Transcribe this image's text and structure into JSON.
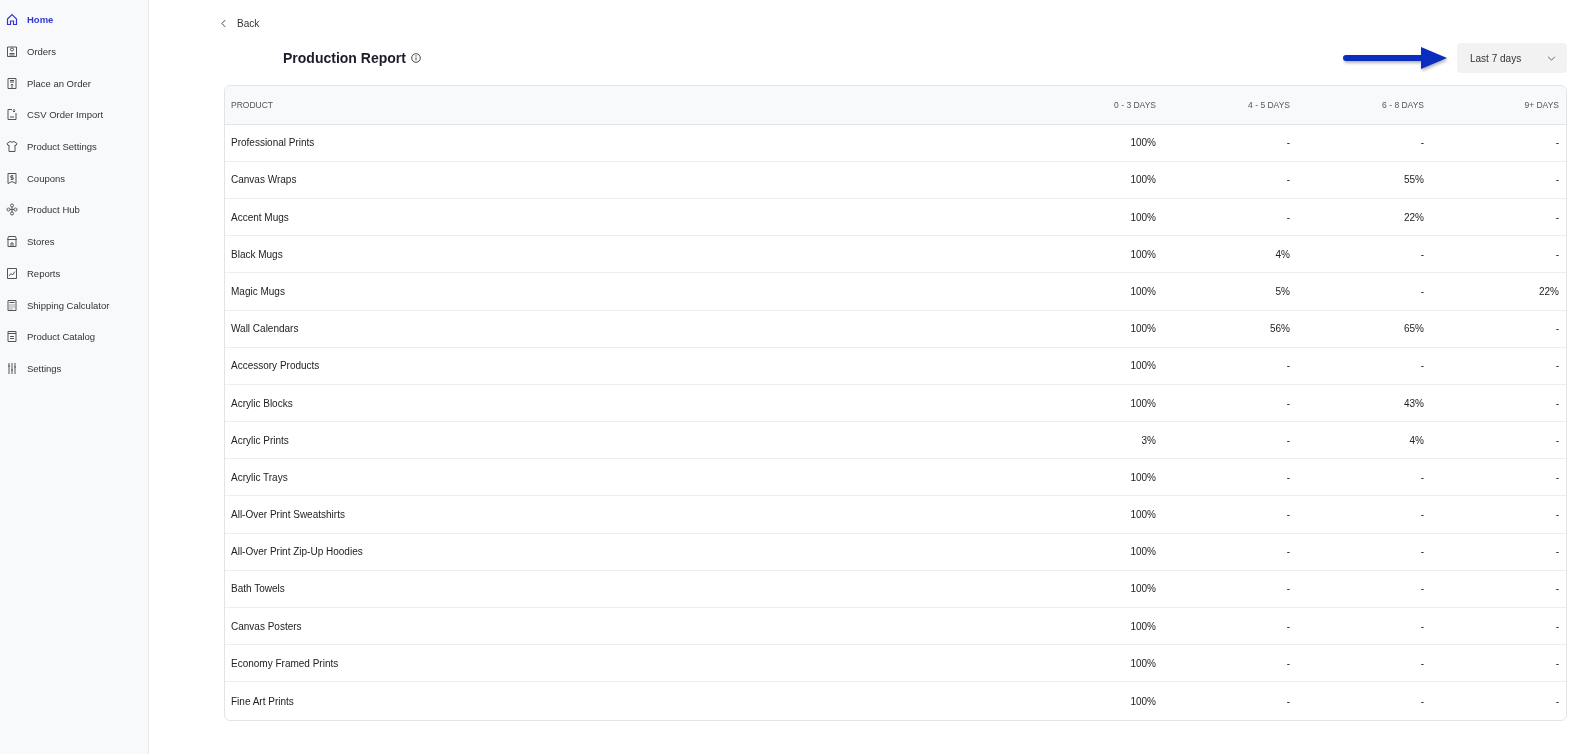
{
  "sidebar": {
    "items": [
      {
        "label": "Home",
        "selected": true
      },
      {
        "label": "Orders",
        "selected": false
      },
      {
        "label": "Place an Order",
        "selected": false
      },
      {
        "label": "CSV Order Import",
        "selected": false
      },
      {
        "label": "Product Settings",
        "selected": false
      },
      {
        "label": "Coupons",
        "selected": false
      },
      {
        "label": "Product Hub",
        "selected": false
      },
      {
        "label": "Stores",
        "selected": false
      },
      {
        "label": "Reports",
        "selected": false
      },
      {
        "label": "Shipping Calculator",
        "selected": false
      },
      {
        "label": "Product Catalog",
        "selected": false
      },
      {
        "label": "Settings",
        "selected": false
      }
    ]
  },
  "back_link": {
    "label": "Back"
  },
  "page_title": "Production Report",
  "date_range": {
    "value": "Last 7 days"
  },
  "table": {
    "columns": [
      "PRODUCT",
      "0 - 3 DAYS",
      "4 - 5 DAYS",
      "6 - 8 DAYS",
      "9+ DAYS"
    ],
    "rows": [
      [
        "Professional Prints",
        "100%",
        "-",
        "-",
        "-"
      ],
      [
        "Canvas Wraps",
        "100%",
        "-",
        "55%",
        "-"
      ],
      [
        "Accent Mugs",
        "100%",
        "-",
        "22%",
        "-"
      ],
      [
        "Black Mugs",
        "100%",
        "4%",
        "-",
        "-"
      ],
      [
        "Magic Mugs",
        "100%",
        "5%",
        "-",
        "22%"
      ],
      [
        "Wall Calendars",
        "100%",
        "56%",
        "65%",
        "-"
      ],
      [
        "Accessory Products",
        "100%",
        "-",
        "-",
        "-"
      ],
      [
        "Acrylic Blocks",
        "100%",
        "-",
        "43%",
        "-"
      ],
      [
        "Acrylic Prints",
        "3%",
        "-",
        "4%",
        "-"
      ],
      [
        "Acrylic Trays",
        "100%",
        "-",
        "-",
        "-"
      ],
      [
        "All-Over Print Sweatshirts",
        "100%",
        "-",
        "-",
        "-"
      ],
      [
        "All-Over Print Zip-Up Hoodies",
        "100%",
        "-",
        "-",
        "-"
      ],
      [
        "Bath Towels",
        "100%",
        "-",
        "-",
        "-"
      ],
      [
        "Canvas Posters",
        "100%",
        "-",
        "-",
        "-"
      ],
      [
        "Economy Framed Prints",
        "100%",
        "-",
        "-",
        "-"
      ],
      [
        "Fine Art Prints",
        "100%",
        "-",
        "-",
        "-"
      ]
    ]
  }
}
